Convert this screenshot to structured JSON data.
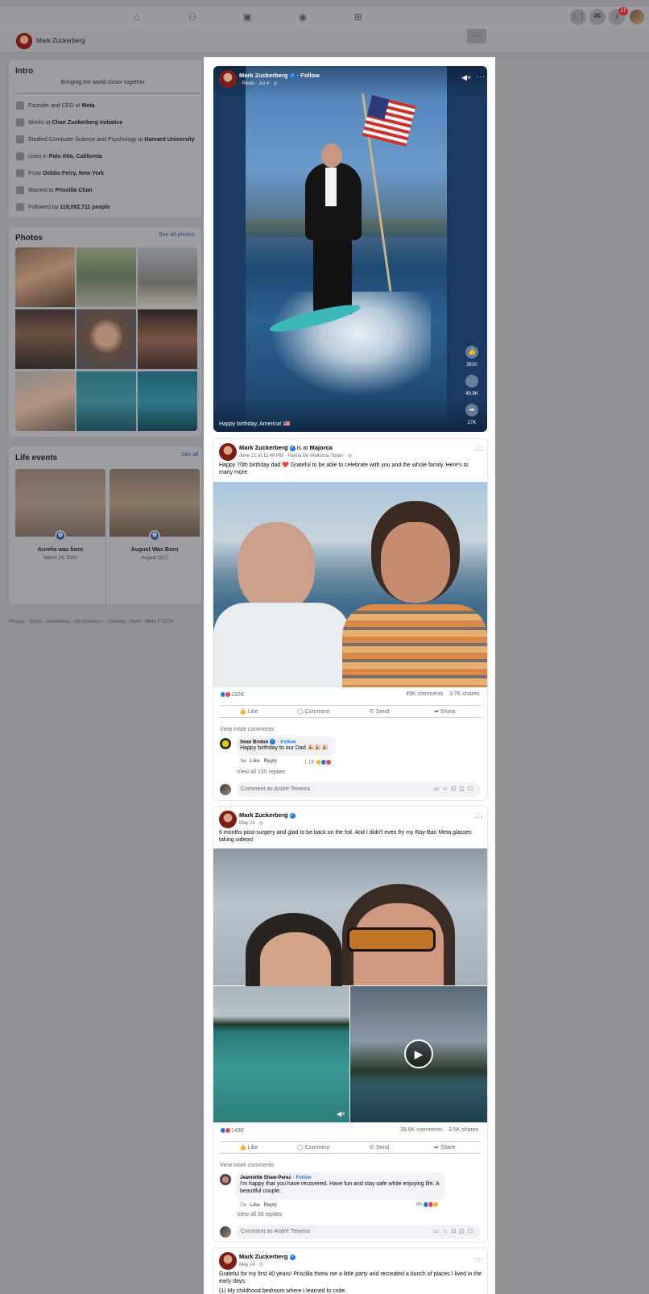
{
  "nav": {
    "icons": [
      "home-icon",
      "friends-icon",
      "video-icon",
      "groups-icon",
      "gaming-icon"
    ],
    "notification_count": "17"
  },
  "profile": {
    "name": "Mark Zuckerberg",
    "more": "···"
  },
  "intro": {
    "title": "Intro",
    "bio": "Bringing the world closer together.",
    "rows": [
      {
        "icon": "work-icon",
        "prefix": "Founder and CEO at ",
        "bold": "Meta",
        "suffix": ""
      },
      {
        "icon": "work-icon",
        "prefix": "Works at ",
        "bold": "Chan Zuckerberg Initiative",
        "suffix": ""
      },
      {
        "icon": "education-icon",
        "prefix": "Studied Computer Science and Psychology at ",
        "bold": "Harvard University",
        "suffix": ""
      },
      {
        "icon": "home-icon",
        "prefix": "Lives in ",
        "bold": "Palo Alto, California",
        "suffix": ""
      },
      {
        "icon": "location-icon",
        "prefix": "From ",
        "bold": "Dobbs Ferry, New York",
        "suffix": ""
      },
      {
        "icon": "heart-icon",
        "prefix": "Married to ",
        "bold": "Priscilla Chan",
        "suffix": ""
      },
      {
        "icon": "rss-icon",
        "prefix": "Followed by ",
        "bold": "119,092,711 people",
        "suffix": ""
      }
    ]
  },
  "photos": {
    "title": "Photos",
    "see_all": "See all photos"
  },
  "life_events": {
    "title": "Life events",
    "see_all": "See all",
    "items": [
      {
        "title": "Aurelia was born",
        "date": "March 24, 2023"
      },
      {
        "title": "August Was Born",
        "date": "August 2017"
      }
    ]
  },
  "footer": "Privacy · Terms · Advertising · Ad Choices ▷ · Cookies · More · Meta © 2024",
  "reel": {
    "name": "Mark Zuckerberg",
    "follow": "· Follow",
    "meta": "· Reels · Jul 4 ·",
    "caption": "Happy birthday, America! 🇺🇸",
    "likes": "381K",
    "comments": "49.9K",
    "shares": "27K"
  },
  "post1": {
    "name": "Mark Zuckerberg",
    "is_at": "is at",
    "place": "Majorca",
    "meta": "June 21 at 11:48 PM · Palma De Mallorca, Spain ·",
    "text": "Happy 70th birthday dad ❤️ Grateful to be able to celebrate with you and the whole family. Here's to many more.",
    "reactions": "192K",
    "comments": "45K comments",
    "shares": "3.7K shares",
    "comment": {
      "name": "Sean Bridon",
      "follow": "Follow",
      "text": "Happy birthday to our Dad 🎉🎉🎉",
      "time": "3w",
      "count": "1.1K"
    },
    "view_replies": "View all 155 replies"
  },
  "post2": {
    "name": "Mark Zuckerberg",
    "meta": "May 24 ·",
    "text": "6 months post-surgery and glad to be back on the foil. And I didn't even fry my Ray-Ban Meta glasses taking videos!",
    "reactions": "149K",
    "comments": "39.6K comments",
    "shares": "3.5K shares",
    "comment": {
      "name": "Jeannette Shaw-Perez",
      "follow": "Follow",
      "text": "I'm happy that you have recovered. Have fun and stay safe while enjoying life. A beautiful couple.",
      "time": "7w",
      "count": "89"
    },
    "view_replies": "View all 56 replies"
  },
  "post3": {
    "name": "Mark Zuckerberg",
    "meta": "May 14 ·",
    "text": "Grateful for my first 40 years! Priscilla threw me a little party and recreated a bunch of places I lived in the early days:",
    "text2": "(1) My childhood bedroom where I learned to code"
  },
  "actions": {
    "like": "Like",
    "comment": "Comment",
    "send": "Send",
    "share": "Share"
  },
  "comment_reply": {
    "like": "Like",
    "reply": "Reply"
  },
  "view_more": "View more comments",
  "comment_input": "Comment as André Teixeira"
}
